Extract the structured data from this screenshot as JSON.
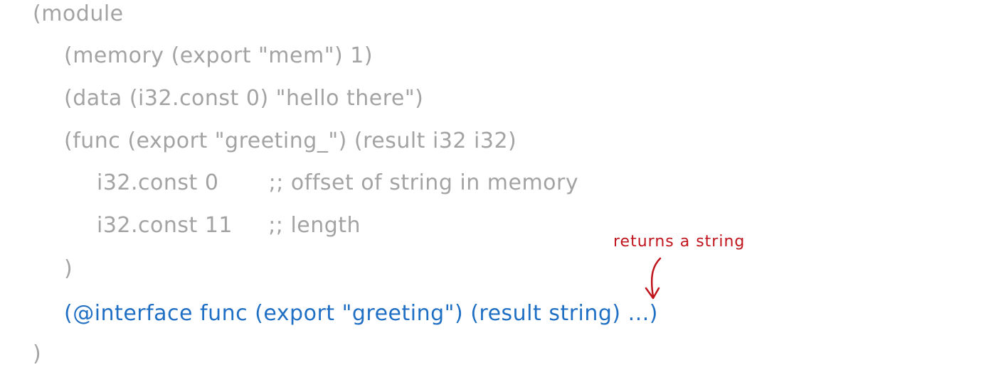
{
  "code": {
    "lines": [
      "(module",
      "(memory (export \"mem\") 1)",
      "(data (i32.const 0) \"hello there\")",
      "(func (export \"greeting_\") (result i32 i32)",
      "i32.const 0       ;; offset of string in memory",
      "i32.const 11     ;; length",
      ")",
      "(@interface func (export \"greeting\") (result string) ...)",
      ")"
    ]
  },
  "annotation": {
    "text": "returns a string",
    "color": "#c0141c"
  },
  "colors": {
    "code_gray": "#a3a3a3",
    "highlight_blue": "#1f6fc4"
  }
}
